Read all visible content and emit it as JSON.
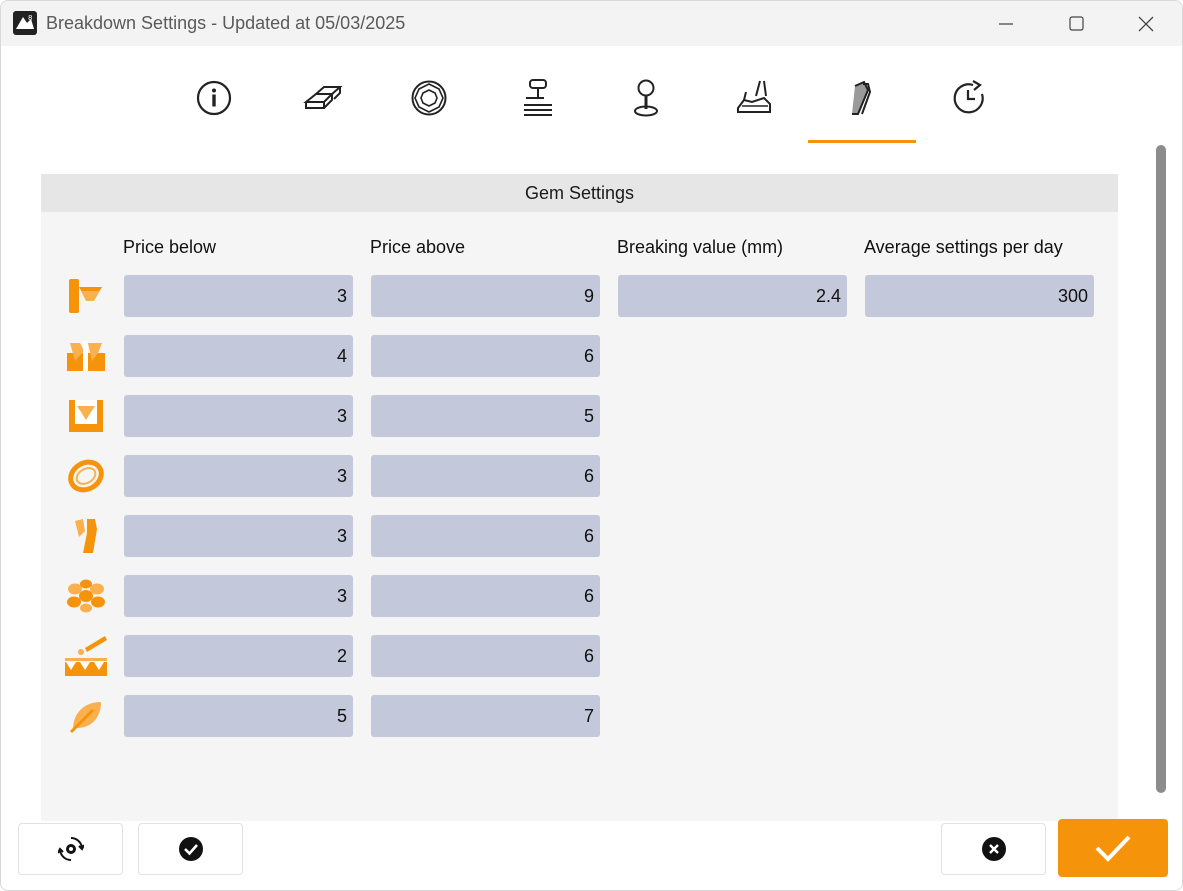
{
  "window": {
    "title": "Breakdown Settings - Updated at 05/03/2025"
  },
  "tabs": [
    {
      "icon": "info-icon"
    },
    {
      "icon": "gold-bars-icon"
    },
    {
      "icon": "diamond-icon"
    },
    {
      "icon": "casting-icon"
    },
    {
      "icon": "joystick-icon"
    },
    {
      "icon": "hand-tool-icon"
    },
    {
      "icon": "gem-setting-icon",
      "active": true
    },
    {
      "icon": "history-icon"
    }
  ],
  "panel": {
    "title": "Gem Settings",
    "columns": {
      "price_below": "Price below",
      "price_above": "Price above",
      "breaking_value": "Breaking value (mm)",
      "avg_settings": "Average settings per day"
    },
    "rows": [
      {
        "icon": "prong-setting-icon",
        "price_below": "3",
        "price_above": "9",
        "breaking_value": "2.4",
        "avg_settings": "300"
      },
      {
        "icon": "channel-setting-icon",
        "price_below": "4",
        "price_above": "6"
      },
      {
        "icon": "bezel-setting-icon",
        "price_below": "3",
        "price_above": "5"
      },
      {
        "icon": "ring-setting-icon",
        "price_below": "3",
        "price_above": "6"
      },
      {
        "icon": "tension-setting-icon",
        "price_below": "3",
        "price_above": "6"
      },
      {
        "icon": "cluster-setting-icon",
        "price_below": "3",
        "price_above": "6"
      },
      {
        "icon": "pave-setting-icon",
        "price_below": "2",
        "price_above": "6"
      },
      {
        "icon": "leaf-setting-icon",
        "price_below": "5",
        "price_above": "7"
      }
    ]
  },
  "colors": {
    "accent": "#f5930a",
    "field_bg": "#c3c8da",
    "panel_bg": "#f5f5f5",
    "header_bg": "#e6e6e6"
  }
}
